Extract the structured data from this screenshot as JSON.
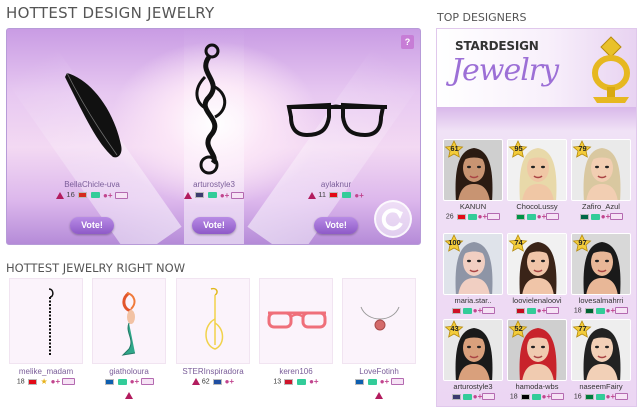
{
  "headings": {
    "main_title": "HOTTEST DESIGN JEWELRY",
    "now_title": "HOTTEST JEWELRY RIGHT NOW",
    "top_title": "TOP DESIGNERS"
  },
  "vote": {
    "help": "?",
    "button_label": "Vote!",
    "entries": [
      {
        "user": "BellaChicle-uva",
        "level": "16",
        "item": "black feather earring",
        "flag_color": "#d52b1e"
      },
      {
        "user": "arturostyle3",
        "level": "",
        "item": "black swirl pendant",
        "flag_color": "#3c3b6e"
      },
      {
        "user": "aylaknur",
        "level": "11",
        "item": "black frame glasses",
        "flag_color": "#e30a17"
      }
    ]
  },
  "hottest_now": [
    {
      "user": "melike_madam",
      "level": "18",
      "item": "black chain earring",
      "flag_color": "#e30a17"
    },
    {
      "user": "giatholoura",
      "level": "",
      "item": "mermaid pendant",
      "flag_color": "#0d5eaf"
    },
    {
      "user": "STERInspiradora",
      "level": "62",
      "item": "gold hoop earring",
      "flag_color": "#1f4ea1"
    },
    {
      "user": "keren106",
      "level": "13",
      "item": "pink glasses",
      "flag_color": "#cf142b"
    },
    {
      "user": "LoveFotinh",
      "level": "",
      "item": "round pendant necklace",
      "flag_color": "#0d5eaf"
    }
  ],
  "brand": {
    "line1": "STARDESIGN",
    "line2": "Jewelry"
  },
  "designers": [
    {
      "level": "61",
      "name": "KANUN",
      "stat": "26",
      "skin": "#c89472",
      "hair": "#2b1b12",
      "bg": "#cfcfcf",
      "flag_color": "#e30a17"
    },
    {
      "level": "95",
      "name": "ChocoLussy",
      "stat": "",
      "skin": "#f0c7a5",
      "hair": "#e8d9a9",
      "bg": "#f1f1f1",
      "flag_color": "#009246"
    },
    {
      "level": "79",
      "name": "Zafiro_Azul",
      "stat": "",
      "skin": "#f2ceb2",
      "hair": "#d9c8a0",
      "bg": "#eaeaea",
      "flag_color": "#006847"
    },
    {
      "level": "100",
      "name": "maria.star..",
      "stat": "",
      "skin": "#f1cfc2",
      "hair": "#8e95a6",
      "bg": "#dfe3ea",
      "flag_color": "#ce1126"
    },
    {
      "level": "74",
      "name": "loovielenaloovi",
      "stat": "",
      "skin": "#f0c5a8",
      "hair": "#3a2418",
      "bg": "#f1f1f1",
      "flag_color": "#c60b1e"
    },
    {
      "level": "97",
      "name": "lovesalmahrri",
      "stat": "18",
      "skin": "#e8b797",
      "hair": "#1a1a1a",
      "bg": "#d8d8d8",
      "flag_color": "#006233"
    },
    {
      "level": "43",
      "name": "arturostyle3",
      "stat": "",
      "skin": "#d9a07c",
      "hair": "#1a1a1a",
      "bg": "#e8e8e8",
      "flag_color": "#3c3b6e"
    },
    {
      "level": "52",
      "name": "hamoda-wbs",
      "stat": "18",
      "skin": "#f0cbb0",
      "hair": "#c8232b",
      "bg": "#cfcfcf",
      "flag_color": "#000000"
    },
    {
      "level": "77",
      "name": "naseemFairy",
      "stat": "16",
      "skin": "#f2d0b7",
      "hair": "#222222",
      "bg": "#eeeeee",
      "flag_color": "#007a3d"
    }
  ]
}
